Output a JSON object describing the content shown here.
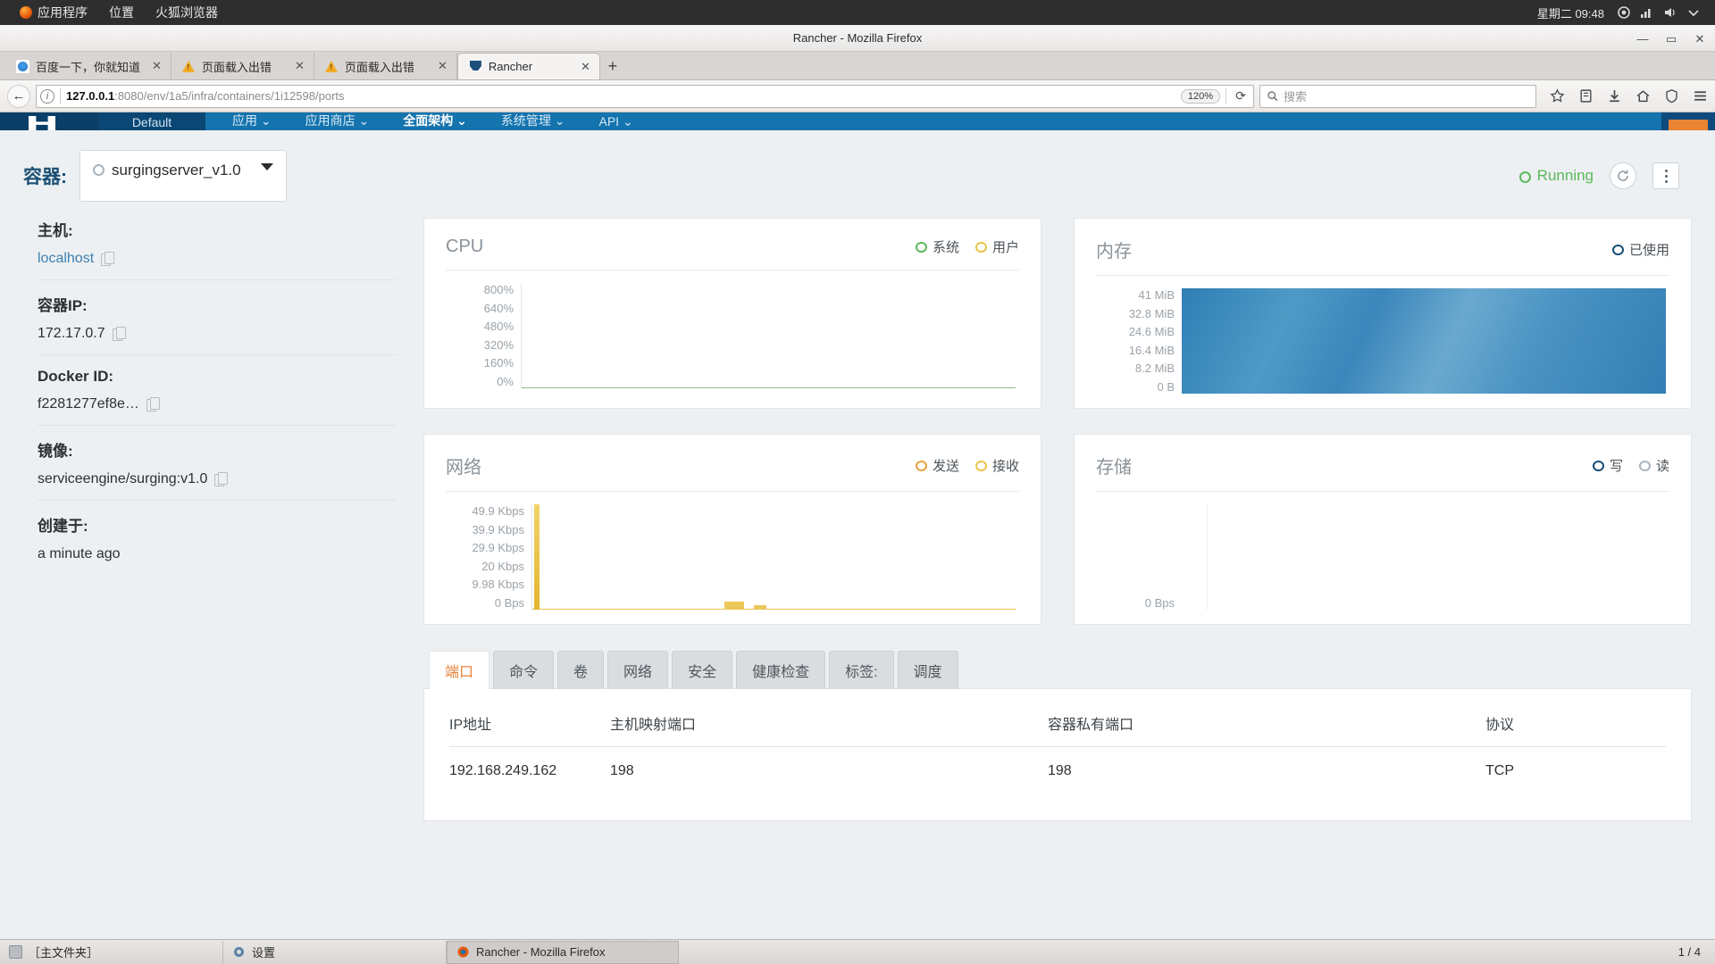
{
  "gnome": {
    "apps_menu": "应用程序",
    "places_menu": "位置",
    "firefox_menu": "火狐浏览器",
    "clock": "星期二 09:48"
  },
  "firefox": {
    "window_title": "Rancher - Mozilla Firefox",
    "minimize": "—",
    "maximize": "▭",
    "close": "✕",
    "tabs": [
      {
        "label": "百度一下，你就知道",
        "icon": "baidu-favicon",
        "close": "✕",
        "active": false
      },
      {
        "label": "页面载入出错",
        "icon": "warning-favicon",
        "close": "✕",
        "active": false
      },
      {
        "label": "页面载入出错",
        "icon": "warning-favicon",
        "close": "✕",
        "active": false
      },
      {
        "label": "Rancher",
        "icon": "rancher-favicon",
        "close": "✕",
        "active": true
      }
    ],
    "new_tab_label": "+",
    "back_icon": "←",
    "url_host": "127.0.0.1",
    "url_path": ":8080/env/1a5/infra/containers/1i12598/ports",
    "zoom_level": "120%",
    "reload_icon": "⟳",
    "search_placeholder": "搜索",
    "nav_icons": [
      "bookmark-star-icon",
      "library-icon",
      "download-icon",
      "home-icon",
      "shield-icon",
      "menu-icon"
    ]
  },
  "rancher_nav": {
    "env_label": "Default",
    "items": [
      {
        "label": "应用 ⌄",
        "bold": false
      },
      {
        "label": "应用商店 ⌄",
        "bold": false
      },
      {
        "label": "全面架构 ⌄",
        "bold": true
      },
      {
        "label": "系统管理 ⌄",
        "bold": false
      },
      {
        "label": "API ⌄",
        "bold": false
      }
    ]
  },
  "header": {
    "title": "容器:",
    "selected_container": "surgingserver_v1.0",
    "status": "Running",
    "refresh_icon": "circle-arrow-icon",
    "menu_icon": "kebab-menu-icon"
  },
  "info": [
    {
      "label": "主机:",
      "value": "localhost",
      "is_link": true,
      "copy": "copy-icon"
    },
    {
      "label": "容器IP:",
      "value": "172.17.0.7",
      "is_link": false,
      "copy": "copy-icon"
    },
    {
      "label": "Docker ID:",
      "value": "f2281277ef8e…",
      "is_link": false,
      "copy": "copy-icon"
    },
    {
      "label": "镜像:",
      "value": "serviceengine/surging:v1.0",
      "is_link": false,
      "copy": "copy-icon"
    },
    {
      "label": "创建于:",
      "value": "a minute ago",
      "is_link": false,
      "copy": ""
    }
  ],
  "chart_data": [
    {
      "type": "line",
      "title": "CPU",
      "legend": [
        {
          "label": "系统",
          "color": "#5cb85c"
        },
        {
          "label": "用户",
          "color": "#e8c34a"
        }
      ],
      "legend_position": "top-right",
      "ylabel": "",
      "xlabel": "",
      "yticks": [
        "800%",
        "640%",
        "480%",
        "320%",
        "160%",
        "0%"
      ],
      "ylim": [
        0,
        800
      ],
      "grid": false,
      "series": [
        {
          "name": "系统",
          "values": [
            0,
            0,
            0,
            0,
            0,
            0,
            0,
            0,
            0,
            0,
            0,
            0
          ]
        },
        {
          "name": "用户",
          "values": [
            0,
            0,
            0,
            0,
            0,
            0,
            0,
            0,
            0,
            0,
            0,
            0
          ]
        }
      ]
    },
    {
      "type": "area",
      "title": "内存",
      "legend": [
        {
          "label": "已使用",
          "color": "#1f6fa8"
        }
      ],
      "legend_position": "top-right",
      "ylabel": "",
      "xlabel": "",
      "yticks": [
        "41 MiB",
        "32.8 MiB",
        "24.6 MiB",
        "16.4 MiB",
        "8.2 MiB",
        "0 B"
      ],
      "ylim": [
        0,
        41
      ],
      "grid": false,
      "series": [
        {
          "name": "已使用",
          "values": [
            41,
            41,
            41,
            41,
            41,
            41,
            41,
            41,
            41,
            41,
            41,
            41
          ]
        }
      ]
    },
    {
      "type": "area",
      "title": "网络",
      "legend": [
        {
          "label": "发送",
          "color": "#e8a33d"
        },
        {
          "label": "接收",
          "color": "#e8c34a"
        }
      ],
      "legend_position": "top-right",
      "ylabel": "",
      "xlabel": "",
      "yticks": [
        "49.9 Kbps",
        "39.9 Kbps",
        "29.9 Kbps",
        "20 Kbps",
        "9.98 Kbps",
        "0 Bps"
      ],
      "ylim": [
        0,
        49.9
      ],
      "grid": false,
      "series": [
        {
          "name": "发送",
          "values": [
            49.9,
            2,
            0.3,
            0.2,
            0.2,
            0.2,
            0.2,
            3.2,
            2.8,
            0.4,
            0.3,
            0.2
          ]
        },
        {
          "name": "接收",
          "values": [
            0.5,
            0.4,
            0.2,
            0.2,
            0.2,
            0.2,
            0.2,
            0.6,
            0.5,
            0.2,
            0.2,
            0.2
          ]
        }
      ]
    },
    {
      "type": "line",
      "title": "存储",
      "legend": [
        {
          "label": "写",
          "color": "#1f6fa8"
        },
        {
          "label": "读",
          "color": "#aab3bb"
        }
      ],
      "legend_position": "top-right",
      "ylabel": "",
      "xlabel": "",
      "yticks": [
        "0 Bps"
      ],
      "ylim": [
        0,
        0
      ],
      "grid": false,
      "series": [
        {
          "name": "写",
          "values": [
            0,
            0,
            0,
            0,
            0,
            0,
            0,
            0,
            0,
            0,
            0,
            0
          ]
        },
        {
          "name": "读",
          "values": [
            0,
            0,
            0,
            0,
            0,
            0,
            0,
            0,
            0,
            0,
            0,
            0
          ]
        }
      ]
    }
  ],
  "tabs": [
    {
      "label": "端口",
      "active": true
    },
    {
      "label": "命令",
      "active": false
    },
    {
      "label": "卷",
      "active": false
    },
    {
      "label": "网络",
      "active": false
    },
    {
      "label": "安全",
      "active": false
    },
    {
      "label": "健康检查",
      "active": false
    },
    {
      "label": "标签:",
      "active": false
    },
    {
      "label": "调度",
      "active": false
    }
  ],
  "ports_table": {
    "columns": [
      "IP地址",
      "主机映射端口",
      "容器私有端口",
      "协议"
    ],
    "rows": [
      {
        "ip": "192.168.249.162",
        "host_port": "198",
        "private_port": "198",
        "protocol": "TCP"
      }
    ]
  },
  "taskbar": {
    "items": [
      {
        "label": "［主文件夹］",
        "icon": "folder-icon"
      },
      {
        "label": "设置",
        "icon": "gear-icon"
      },
      {
        "label": "Rancher - Mozilla Firefox",
        "icon": "firefox-icon"
      }
    ],
    "workspace": "1 / 4"
  }
}
